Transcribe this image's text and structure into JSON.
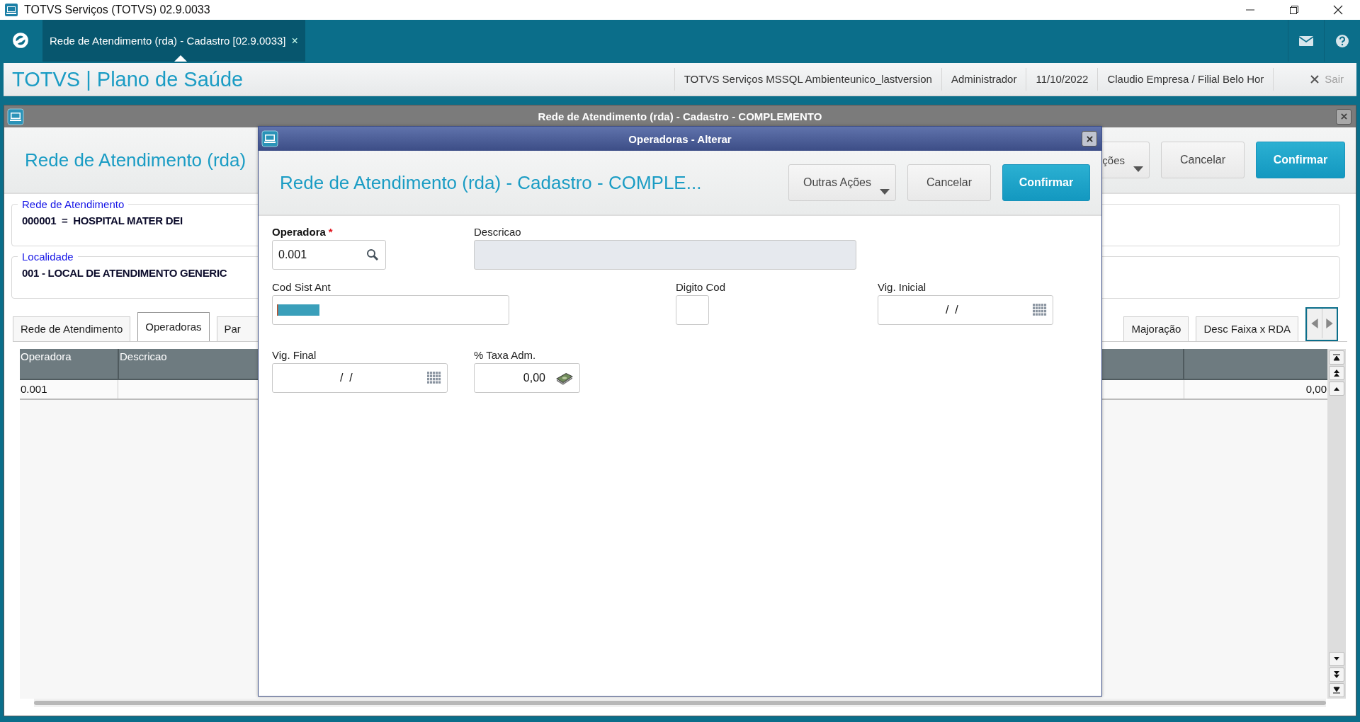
{
  "app_window": {
    "title": "TOTVS Serviços (TOTVS) 02.9.0033"
  },
  "tab_bar": {
    "tabs": [
      {
        "label": "Rede de Atendimento (rda) - Cadastro [02.9.0033]",
        "close": "×",
        "selected": true
      }
    ]
  },
  "header": {
    "brand": "TOTVS | Plano de Saúde",
    "info": [
      "TOTVS Serviços MSSQL Ambienteunico_lastversion",
      "Administrador",
      "11/10/2022",
      "Claudio Empresa / Filial Belo Hor"
    ],
    "logout": {
      "label": "Sair",
      "disabled": true
    }
  },
  "back_window": {
    "title": "Rede de Atendimento (rda) - Cadastro - COMPLEMENTO",
    "heading": "Rede de Atendimento (rda)",
    "buttons": [
      {
        "label": "ções",
        "kind": "menu"
      },
      {
        "label": "Cancelar",
        "kind": "default"
      },
      {
        "label": "Confirmar",
        "kind": "primary"
      }
    ],
    "groups": [
      {
        "legend": "Rede de Atendimento",
        "value": "000001  =  HOSPITAL MATER DEI"
      },
      {
        "legend": "Localidade",
        "value": "001 - LOCAL DE ATENDIMENTO GENERIC"
      }
    ],
    "tabs": [
      {
        "label": "Rede de Atendimento",
        "selected": false
      },
      {
        "label": "Operadoras",
        "selected": true
      },
      {
        "label": "Par",
        "selected": false
      },
      {
        "label": "Majoração",
        "selected": false
      },
      {
        "label": "Desc Faixa x RDA",
        "selected": false
      }
    ],
    "table": {
      "columns": [
        "Operadora",
        "Descricao"
      ],
      "rows": [
        {
          "cells": [
            "0.001",
            "",
            "0,00"
          ]
        }
      ]
    }
  },
  "dialog": {
    "title": "Operadoras - Alterar",
    "heading": "Rede de Atendimento (rda) - Cadastro - COMPLE...",
    "buttons": [
      {
        "label": "Outras Ações",
        "kind": "menu"
      },
      {
        "label": "Cancelar",
        "kind": "default"
      },
      {
        "label": "Confirmar",
        "kind": "primary"
      }
    ],
    "fields": [
      {
        "label": "Operadora",
        "required_mark": "*",
        "value": "0.001",
        "kind": "lookup",
        "disabled": false
      },
      {
        "label": "Descricao",
        "kind": "text",
        "disabled": true
      },
      {
        "label": "Cod Sist Ant",
        "kind": "highlighted",
        "disabled": false
      },
      {
        "label": "Digito Cod",
        "kind": "text",
        "disabled": false
      },
      {
        "label": "Vig. Inicial",
        "value": "  /  /",
        "kind": "date",
        "disabled": false
      },
      {
        "label": "Vig. Final",
        "value": "  /  /",
        "kind": "date",
        "disabled": false
      },
      {
        "label": "% Taxa Adm.",
        "value": "0,00",
        "kind": "money",
        "disabled": false
      }
    ]
  }
}
